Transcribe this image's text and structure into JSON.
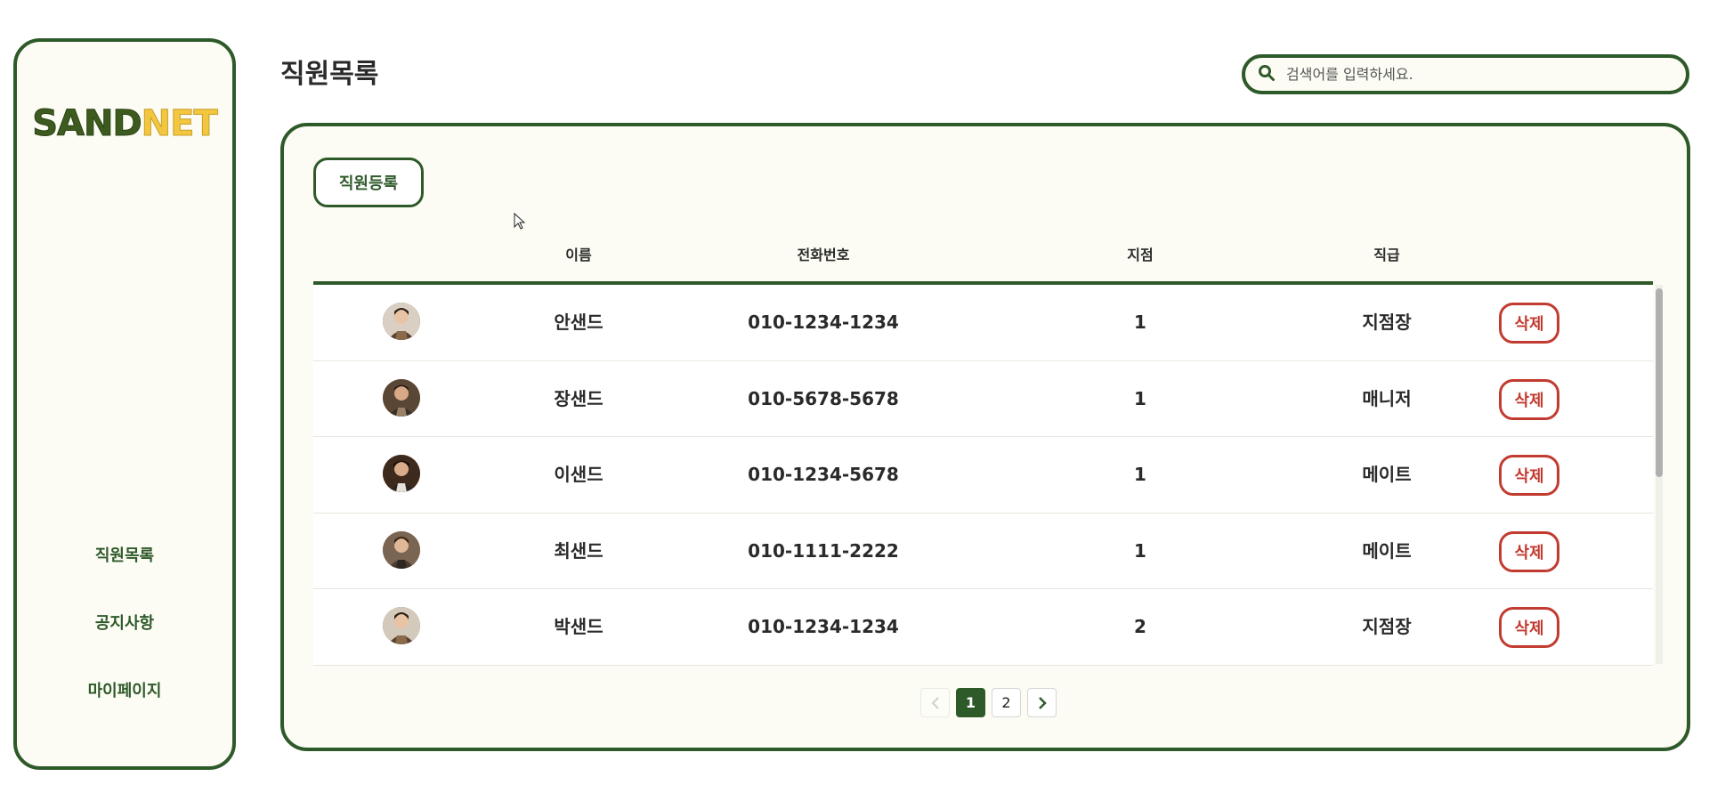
{
  "sidebar": {
    "logo_part1": "SAND",
    "logo_part2": "NET",
    "items": [
      {
        "label": "직원목록"
      },
      {
        "label": "공지사항"
      },
      {
        "label": "마이페이지"
      }
    ]
  },
  "header": {
    "title": "직원목록",
    "search_placeholder": "검색어를 입력하세요."
  },
  "main": {
    "register_label": "직원등록",
    "columns": [
      "이름",
      "전화번호",
      "지점",
      "직급"
    ],
    "rows": [
      {
        "name": "안샌드",
        "phone": "010-1234-1234",
        "branch": "1",
        "rank": "지점장",
        "delete_label": "삭제"
      },
      {
        "name": "장샌드",
        "phone": "010-5678-5678",
        "branch": "1",
        "rank": "매니저",
        "delete_label": "삭제"
      },
      {
        "name": "이샌드",
        "phone": "010-1234-5678",
        "branch": "1",
        "rank": "메이트",
        "delete_label": "삭제"
      },
      {
        "name": "최샌드",
        "phone": "010-1111-2222",
        "branch": "1",
        "rank": "메이트",
        "delete_label": "삭제"
      },
      {
        "name": "박샌드",
        "phone": "010-1234-1234",
        "branch": "2",
        "rank": "지점장",
        "delete_label": "삭제"
      }
    ],
    "pagination": {
      "pages": [
        "1",
        "2"
      ],
      "current": "1"
    }
  },
  "colors": {
    "accent": "#2e5a2a",
    "danger": "#c23b30",
    "logo_yellow": "#f3c640"
  }
}
